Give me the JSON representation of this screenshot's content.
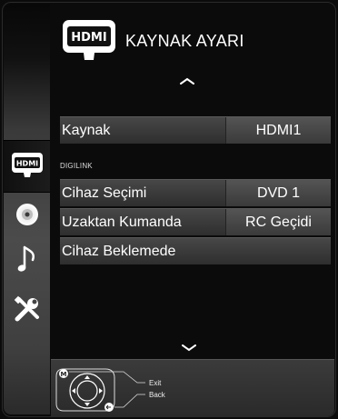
{
  "header": {
    "title": "KAYNAK AYARI",
    "icon": "hdmi-icon"
  },
  "sidebar": {
    "items": [
      {
        "name": "hdmi",
        "icon": "hdmi-icon",
        "active": true
      },
      {
        "name": "disc",
        "icon": "disc-icon",
        "active": false
      },
      {
        "name": "music",
        "icon": "music-note-icon",
        "active": false
      },
      {
        "name": "tools",
        "icon": "tools-icon",
        "active": false
      }
    ]
  },
  "menu": {
    "source": {
      "label": "Kaynak",
      "value": "HDMI1"
    },
    "section_label": "DIGILINK",
    "device_select": {
      "label": "Cihaz Seçimi",
      "value": "DVD 1"
    },
    "remote_control": {
      "label": "Uzaktan Kumanda",
      "value": "RC Geçidi"
    },
    "device_standby": {
      "label": "Cihaz Beklemede"
    }
  },
  "footer": {
    "menu_key": "M",
    "exit_label": "Exit",
    "back_label": "Back"
  },
  "colors": {
    "background": "#0b0b0b",
    "row": "#3a3a3a",
    "value_cell": "#4a4a4a",
    "text": "#ffffff"
  }
}
